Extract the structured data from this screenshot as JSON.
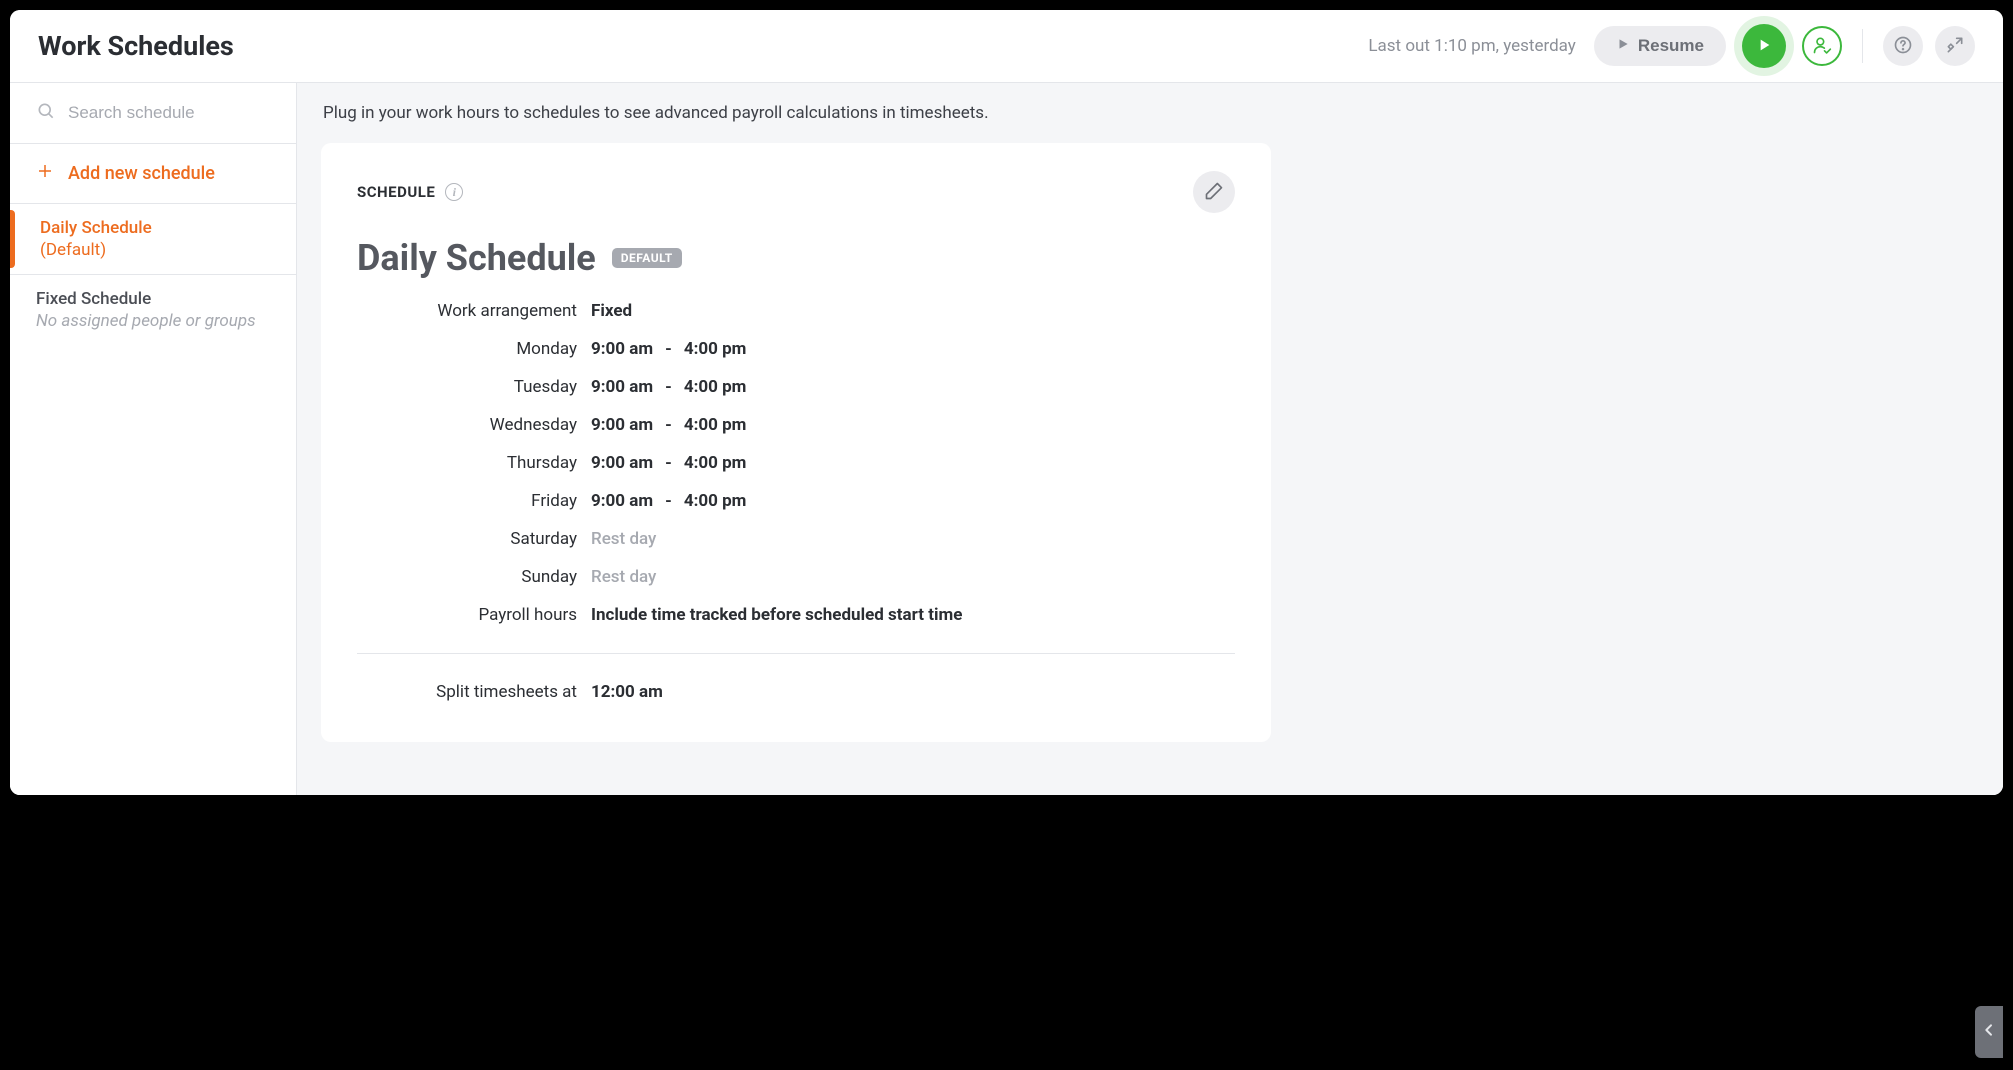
{
  "header": {
    "title": "Work Schedules",
    "last_out": "Last out 1:10 pm, yesterday",
    "resume_label": "Resume"
  },
  "sidebar": {
    "search_placeholder": "Search schedule",
    "add_label": "Add new schedule",
    "items": [
      {
        "title": "Daily Schedule",
        "subtitle": "(Default)",
        "active": true
      },
      {
        "title": "Fixed Schedule",
        "subtitle": "No assigned people or groups",
        "italic": true,
        "active": false
      }
    ]
  },
  "main": {
    "lead": "Plug in your work hours to schedules to see advanced payroll calculations in timesheets.",
    "section_label": "SCHEDULE",
    "title": "Daily Schedule",
    "default_badge": "DEFAULT",
    "arrangement_label": "Work arrangement",
    "arrangement_value": "Fixed",
    "days": [
      {
        "day": "Monday",
        "start": "9:00 am",
        "end": "4:00 pm"
      },
      {
        "day": "Tuesday",
        "start": "9:00 am",
        "end": "4:00 pm"
      },
      {
        "day": "Wednesday",
        "start": "9:00 am",
        "end": "4:00 pm"
      },
      {
        "day": "Thursday",
        "start": "9:00 am",
        "end": "4:00 pm"
      },
      {
        "day": "Friday",
        "start": "9:00 am",
        "end": "4:00 pm"
      },
      {
        "day": "Saturday",
        "rest": "Rest day"
      },
      {
        "day": "Sunday",
        "rest": "Rest day"
      }
    ],
    "payroll_label": "Payroll hours",
    "payroll_value": "Include time tracked before scheduled start time",
    "split_label": "Split timesheets at",
    "split_value": "12:00 am"
  }
}
